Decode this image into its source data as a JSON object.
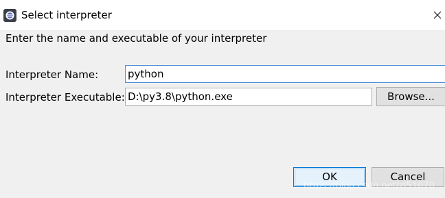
{
  "window": {
    "title": "Select interpreter",
    "app_icon": "eclipse-icon",
    "close_icon": "close-icon"
  },
  "dialog": {
    "message": "Enter the name and executable of your interpreter",
    "name_label": "Interpreter Name:",
    "name_value": "python",
    "exec_label": "Interpreter Executable:",
    "exec_value": "D:\\py3.8\\python.exe",
    "browse_label": "Browse...",
    "ok_label": "OK",
    "cancel_label": "Cancel"
  },
  "watermark": "https://blog.csdn.net/zl51070",
  "colors": {
    "accent": "#0078d7",
    "panel_bg": "#f0f0f0",
    "button_bg": "#e1e1e1"
  }
}
